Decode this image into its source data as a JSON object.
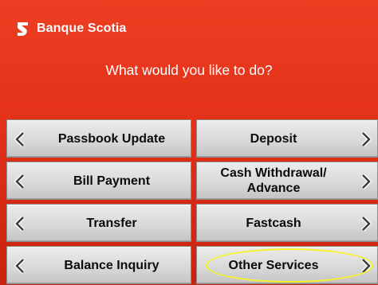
{
  "brand": {
    "logo_icon": "scotiabank-s-logo-icon",
    "name": "Banque Scotia"
  },
  "prompt": "What would you like to do?",
  "options": {
    "passbook_update": "Passbook Update",
    "deposit": "Deposit",
    "bill_payment": "Bill Payment",
    "cash_withdrawal_line1": "Cash Withdrawal/",
    "cash_withdrawal_line2": "Advance",
    "transfer": "Transfer",
    "fastcash": "Fastcash",
    "balance_inquiry": "Balance Inquiry",
    "other_services": "Other Services"
  },
  "icons": {
    "left": "chevron-left-icon",
    "right": "chevron-right-icon"
  },
  "colors": {
    "screen_bg": "#e8351c",
    "button_face": "#d9d9d9",
    "highlight": "#f6f22a"
  }
}
